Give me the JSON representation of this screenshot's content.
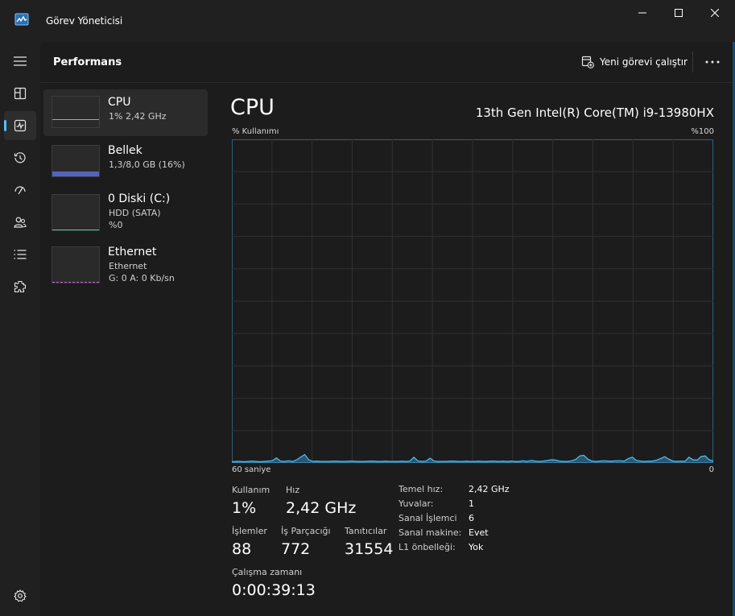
{
  "app": {
    "title": "Görev Yöneticisi"
  },
  "toolbar": {
    "title": "Performans",
    "new_task_label": "Yeni görevi çalıştır"
  },
  "nav": [
    {
      "name": "hamburger-icon",
      "active": false
    },
    {
      "name": "processes-icon",
      "active": false
    },
    {
      "name": "performance-icon",
      "active": true
    },
    {
      "name": "app-history-icon",
      "active": false
    },
    {
      "name": "startup-apps-icon",
      "active": false
    },
    {
      "name": "users-icon",
      "active": false
    },
    {
      "name": "details-icon",
      "active": false
    },
    {
      "name": "services-icon",
      "active": false
    },
    {
      "name": "settings-icon",
      "active": false
    }
  ],
  "resources": [
    {
      "name": "CPU",
      "line1": "1%  2,42 GHz"
    },
    {
      "name": "Bellek",
      "line1": "1,3/8,0 GB (16%)"
    },
    {
      "name": "0 Diski (C:)",
      "line1": "HDD (SATA)",
      "line2": "%0"
    },
    {
      "name": "Ethernet",
      "line1": "Ethernet",
      "line2": "G: 0 A: 0 Kb/sn"
    }
  ],
  "detail": {
    "title": "CPU",
    "model": "13th Gen Intel(R) Core(TM) i9-13980HX",
    "graph_label_left": "% Kullanımı",
    "graph_label_right": "%100",
    "graph_bottom_left": "60 saniye",
    "graph_bottom_right": "0",
    "accent_color": "#4cc2ff",
    "cpu_history": [
      0.4,
      0.5,
      0.5,
      0.4,
      0.5,
      0.6,
      0.5,
      0.4,
      0.5,
      0.6,
      0.7,
      1.6,
      0.6,
      0.5,
      0.7,
      0.5,
      1.0,
      1.8,
      2.6,
      1.0,
      0.5,
      0.6,
      0.5,
      0.5,
      0.5,
      0.6,
      0.6,
      0.5,
      0.5,
      0.6,
      0.6,
      0.5,
      0.5,
      0.5,
      0.6,
      0.6,
      0.5,
      0.5,
      0.6,
      0.5,
      0.5,
      0.5,
      0.6,
      0.5,
      0.6,
      1.8,
      0.6,
      0.5,
      0.6,
      1.5,
      0.6,
      0.5,
      0.5,
      0.5,
      0.6,
      0.6,
      0.5,
      0.5,
      0.6,
      0.5,
      0.5,
      0.6,
      0.5,
      0.5,
      0.6,
      0.6,
      0.5,
      0.6,
      0.5,
      0.6,
      0.5,
      0.5,
      0.7,
      0.5,
      0.8,
      0.6,
      0.5,
      0.6,
      0.8,
      1.0,
      0.9,
      0.6,
      0.5,
      0.5,
      0.7,
      1.1,
      2.2,
      2.4,
      1.2,
      0.6,
      0.5,
      0.6,
      0.7,
      0.6,
      0.6,
      0.7,
      0.7,
      0.6,
      1.4,
      1.8,
      0.8,
      0.6,
      0.5,
      0.6,
      0.6,
      0.9,
      1.4,
      2.0,
      1.2,
      0.6,
      0.5,
      0.6,
      0.5,
      1.8,
      1.0,
      0.9,
      2.0,
      2.2,
      1.0,
      0.6
    ],
    "stats": {
      "usage_label": "Kullanım",
      "usage_value": "1%",
      "speed_label": "Hız",
      "speed_value": "2,42 GHz",
      "processes_label": "İşlemler",
      "processes_value": "88",
      "threads_label": "İş Parçacığı",
      "threads_value": "772",
      "handles_label": "Tanıtıcılar",
      "handles_value": "31554",
      "uptime_label": "Çalışma zamanı",
      "uptime_value": "0:00:39:13"
    },
    "specs": [
      {
        "key": "Temel hız:",
        "value": "2,42 GHz"
      },
      {
        "key": "Yuvalar:",
        "value": "1"
      },
      {
        "key": "Sanal İşlemci",
        "value": "6"
      },
      {
        "key": "Sanal makine:",
        "value": "Evet"
      },
      {
        "key": "L1 önbelleği:",
        "value": "Yok"
      }
    ]
  }
}
